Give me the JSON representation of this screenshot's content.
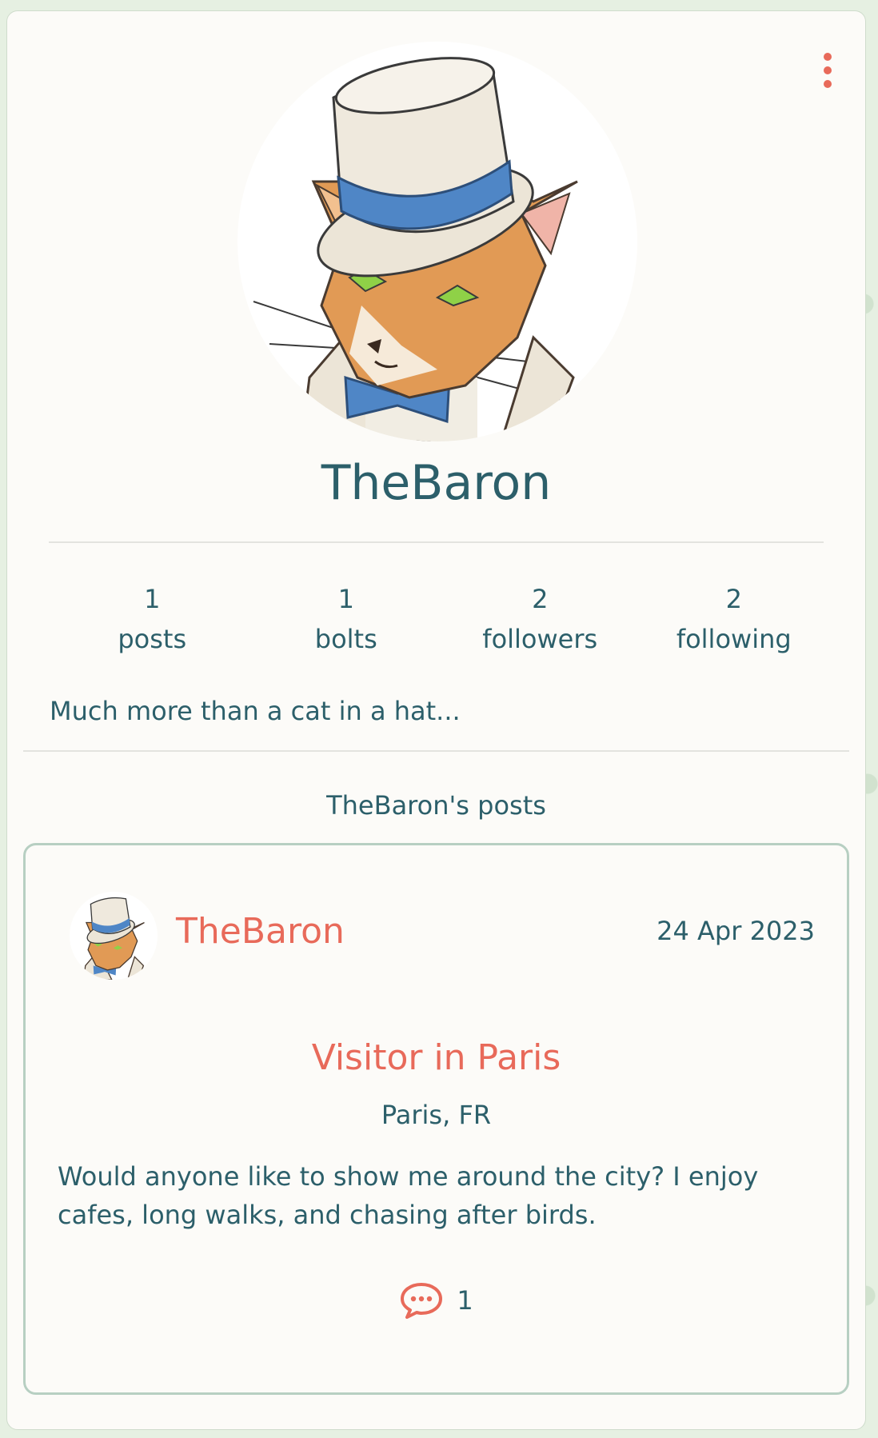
{
  "profile": {
    "username": "TheBaron",
    "bio": "Much more than a cat in a hat...",
    "stats": [
      {
        "value": "1",
        "label": "posts"
      },
      {
        "value": "1",
        "label": "bolts"
      },
      {
        "value": "2",
        "label": "followers"
      },
      {
        "value": "2",
        "label": "following"
      }
    ]
  },
  "posts_section": {
    "heading": "TheBaron's posts"
  },
  "post": {
    "author": "TheBaron",
    "date": "24 Apr 2023",
    "title": "Visitor in Paris",
    "location": "Paris, FR",
    "body": "Would anyone like to show me around the city? I enjoy cafes, long walks, and chasing after birds.",
    "comment_count": "1"
  },
  "icons": {
    "menu": "more-vertical-icon",
    "comments": "chat-bubble-icon"
  },
  "colors": {
    "accent": "#e86a5a",
    "text": "#2c5f6a",
    "background": "#e6f0e2",
    "card": "#fcfbf8",
    "post_border": "#b7cfc2"
  }
}
